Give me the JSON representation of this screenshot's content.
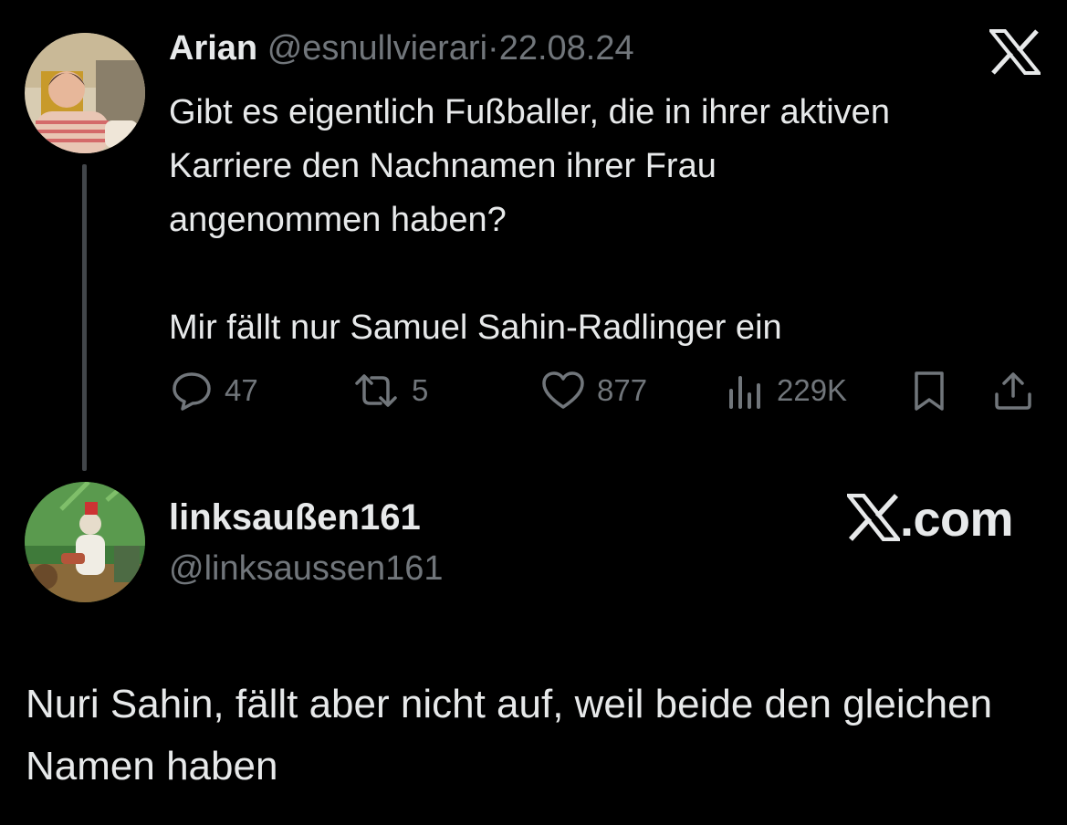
{
  "tweet": {
    "author_name": "Arian",
    "author_handle": "@esnullvierari",
    "separator": "·",
    "date": "22.08.24",
    "text": "Gibt es eigentlich Fußballer, die in ihrer aktiven\nKarriere den Nachnamen ihrer Frau\nangenommen haben?\n\nMir fällt nur Samuel Sahin-Radlinger ein",
    "actions": {
      "replies": "47",
      "reposts": "5",
      "likes": "877",
      "views": "229K"
    }
  },
  "reply": {
    "author_name": "linksaußen161",
    "author_handle": "@linksaussen161",
    "brand_suffix": ".com",
    "text": "Nuri Sahin, fällt aber nicht auf, weil beide den gleichen Namen haben"
  },
  "colors": {
    "background": "#000000",
    "text_primary": "#e7e9ea",
    "text_secondary": "#71767b",
    "thread_line": "#42464a"
  },
  "icons": [
    "x-logo-icon",
    "reply-icon",
    "repost-icon",
    "like-icon",
    "views-icon",
    "bookmark-icon",
    "share-icon"
  ]
}
